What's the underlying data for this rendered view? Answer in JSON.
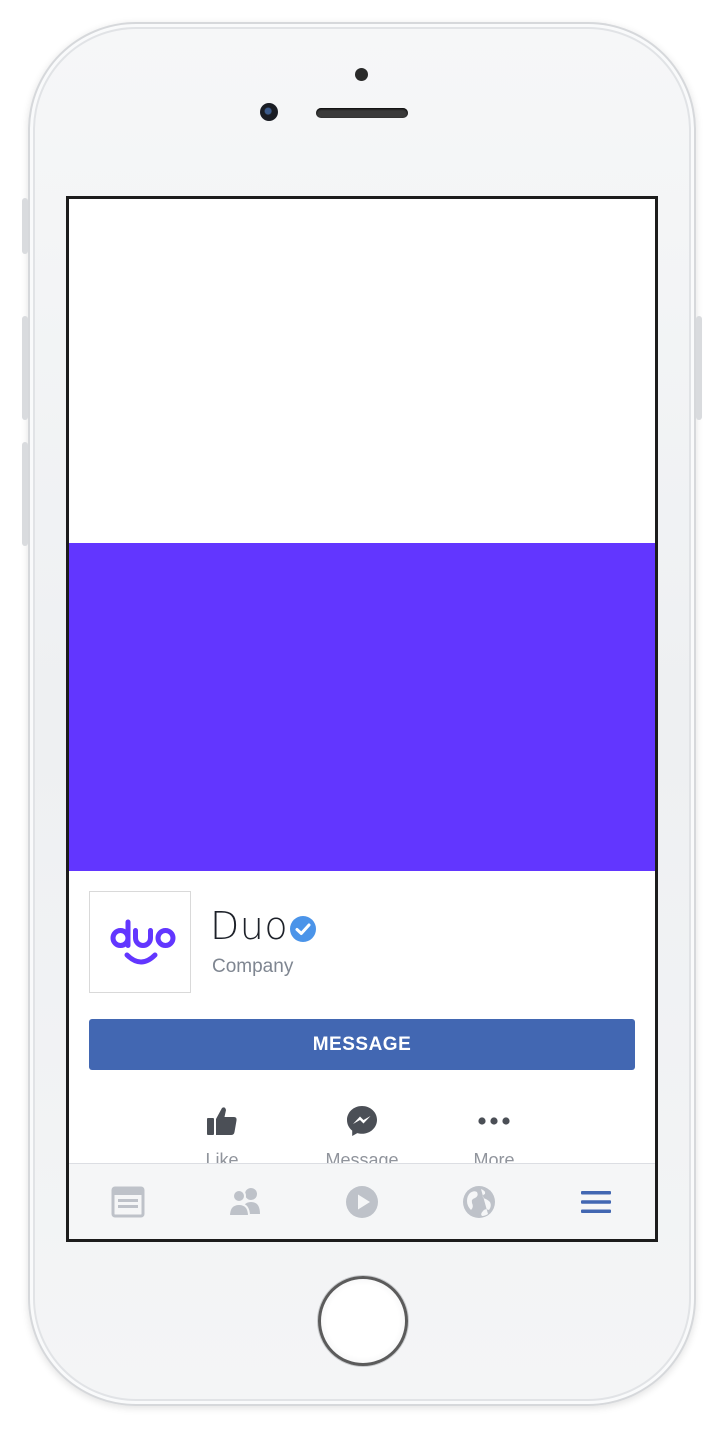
{
  "page": {
    "name": "Duo",
    "category": "Company",
    "avatar_text": "duo",
    "verified": true
  },
  "colors": {
    "cover": "#6236ff",
    "brand": "#6236ff",
    "message_button": "#4267b2",
    "verified_badge": "#4b94e9",
    "tab_active": "#4267b2",
    "tab_inactive": "#bec2c9"
  },
  "buttons": {
    "message_label": "MESSAGE"
  },
  "actions": [
    {
      "label": "Like",
      "icon": "thumbs-up-icon"
    },
    {
      "label": "Message",
      "icon": "messenger-icon"
    },
    {
      "label": "More",
      "icon": "more-dots-icon"
    }
  ],
  "tabbar": {
    "tabs": [
      {
        "name": "news-feed",
        "icon": "news-feed-icon",
        "active": false
      },
      {
        "name": "friends",
        "icon": "friends-icon",
        "active": false
      },
      {
        "name": "watch",
        "icon": "play-icon",
        "active": false
      },
      {
        "name": "notifications",
        "icon": "globe-icon",
        "active": false
      },
      {
        "name": "menu",
        "icon": "hamburger-menu-icon",
        "active": true
      }
    ]
  }
}
